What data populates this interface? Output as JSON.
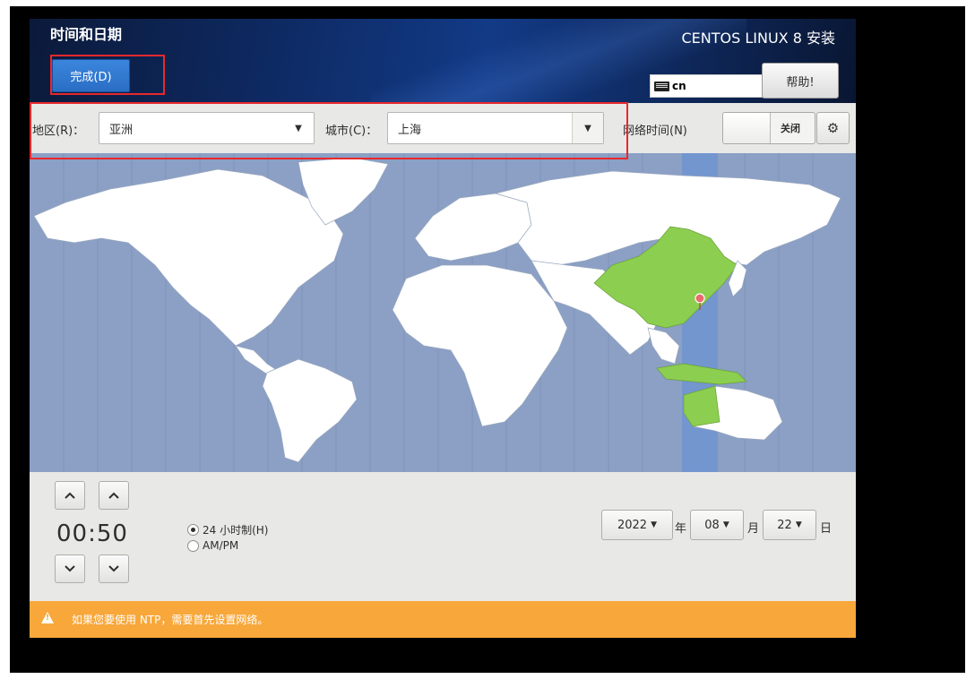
{
  "header": {
    "title": "时间和日期",
    "done_label": "完成(D)",
    "product": "CENTOS LINUX 8 安装",
    "keyboard_layout": "cn",
    "help_label": "帮助!"
  },
  "toolbar": {
    "region_label": "地区(R)：",
    "region_value": "亚洲",
    "city_label": "城市(C)：",
    "city_value": "上海",
    "network_time_label": "网络时间(N)",
    "network_time_state": "关闭"
  },
  "map": {
    "selected_timezone": "Asia/Shanghai",
    "highlight_color": "#7c9bd0",
    "selected_country_color": "#8cce4f"
  },
  "time": {
    "display": "00:50",
    "format_24h_label": "24 小时制(H)",
    "format_ampm_label": "AM/PM",
    "selected_format": "24h"
  },
  "date": {
    "year": "2022",
    "year_unit": "年",
    "month": "08",
    "month_unit": "月",
    "day": "22",
    "day_unit": "日"
  },
  "warning": {
    "text": "如果您要使用 NTP，需要首先设置网络。",
    "icon": "warning-icon"
  }
}
